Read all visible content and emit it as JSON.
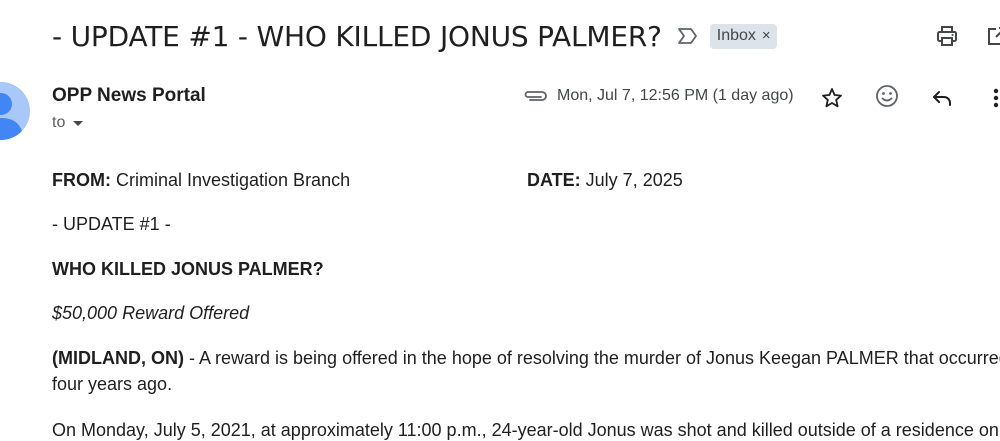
{
  "email": {
    "subject": "- UPDATE #1 - WHO KILLED JONUS PALMER?",
    "label": "Inbox",
    "label_remove": "×",
    "sender": "OPP News Portal",
    "to_label": "to",
    "date_text": "Mon, Jul 7, 12:56 PM (1 day ago)"
  },
  "icons": {
    "important": "important-marker-icon",
    "print": "print-icon",
    "popout": "open-in-new-window-icon",
    "attachment": "paperclip-icon",
    "star": "star-icon",
    "emoji": "emoji-reaction-icon",
    "reply": "reply-icon",
    "more": "more-vert-icon",
    "avatar": "default-avatar-icon"
  },
  "body": {
    "from_label": "FROM:",
    "from_value": " Criminal Investigation Branch",
    "date_label": "DATE:",
    "date_value": " July 7, 2025",
    "update_line": "- UPDATE #1 -",
    "headline": "WHO KILLED JONUS PALMER?",
    "reward": "$50,000 Reward Offered",
    "dateline": "(MIDLAND, ON)",
    "para1_line1": " - A reward is being offered in the hope of resolving the murder of Jonus Keegan PALMER that occurred",
    "para1_line2": "four years ago.",
    "para2_line1": "On Monday, July 5, 2021, at approximately 11:00 p.m., 24-year-old Jonus was shot and killed outside of a residence on"
  },
  "colors": {
    "label_chip_bg": "#dde3ea",
    "avatar_bg": "#a8c7fa",
    "avatar_fg": "#4285f4",
    "icon_gray": "#444746"
  }
}
